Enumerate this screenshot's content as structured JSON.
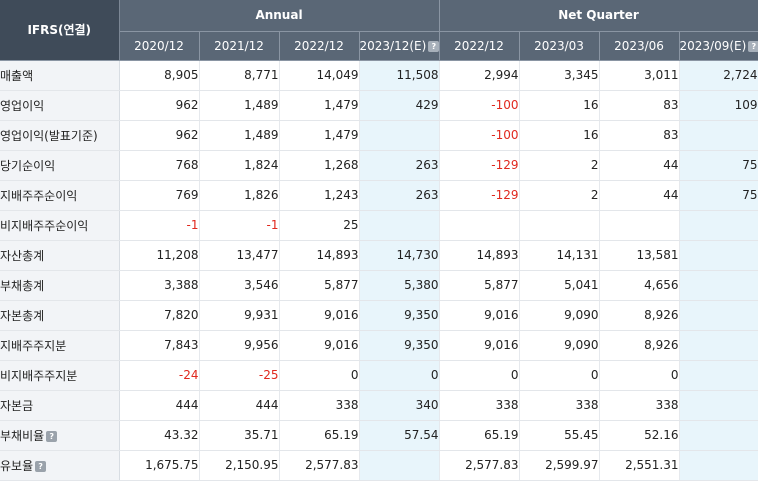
{
  "header": {
    "ifrs_label": "IFRS(연결)",
    "annual_label": "Annual",
    "quarter_label": "Net Quarter",
    "annual_periods": [
      "2020/12",
      "2021/12",
      "2022/12",
      "2023/12(E)"
    ],
    "quarter_periods": [
      "2022/12",
      "2023/03",
      "2023/06",
      "2023/09(E)"
    ],
    "help_glyph": "?"
  },
  "rows": [
    {
      "label": "매출액",
      "indent": false,
      "help": false,
      "values": [
        "8,905",
        "8,771",
        "14,049",
        "11,508",
        "2,994",
        "3,345",
        "3,011",
        "2,724"
      ]
    },
    {
      "label": "영업이익",
      "indent": false,
      "help": false,
      "values": [
        "962",
        "1,489",
        "1,479",
        "429",
        "-100",
        "16",
        "83",
        "109"
      ]
    },
    {
      "label": "영업이익(발표기준)",
      "indent": false,
      "help": false,
      "values": [
        "962",
        "1,489",
        "1,479",
        "",
        "-100",
        "16",
        "83",
        ""
      ]
    },
    {
      "label": "당기순이익",
      "indent": false,
      "help": false,
      "values": [
        "768",
        "1,824",
        "1,268",
        "263",
        "-129",
        "2",
        "44",
        "75"
      ]
    },
    {
      "label": "지배주주순이익",
      "indent": true,
      "help": false,
      "values": [
        "769",
        "1,826",
        "1,243",
        "263",
        "-129",
        "2",
        "44",
        "75"
      ]
    },
    {
      "label": "비지배주주순이익",
      "indent": true,
      "help": false,
      "values": [
        "-1",
        "-1",
        "25",
        "",
        "",
        "",
        "",
        ""
      ]
    },
    {
      "label": "자산총계",
      "indent": false,
      "help": false,
      "values": [
        "11,208",
        "13,477",
        "14,893",
        "14,730",
        "14,893",
        "14,131",
        "13,581",
        ""
      ]
    },
    {
      "label": "부채총계",
      "indent": false,
      "help": false,
      "values": [
        "3,388",
        "3,546",
        "5,877",
        "5,380",
        "5,877",
        "5,041",
        "4,656",
        ""
      ]
    },
    {
      "label": "자본총계",
      "indent": false,
      "help": false,
      "values": [
        "7,820",
        "9,931",
        "9,016",
        "9,350",
        "9,016",
        "9,090",
        "8,926",
        ""
      ]
    },
    {
      "label": "지배주주지분",
      "indent": true,
      "help": false,
      "values": [
        "7,843",
        "9,956",
        "9,016",
        "9,350",
        "9,016",
        "9,090",
        "8,926",
        ""
      ]
    },
    {
      "label": "비지배주주지분",
      "indent": true,
      "help": false,
      "values": [
        "-24",
        "-25",
        "0",
        "0",
        "0",
        "0",
        "0",
        ""
      ]
    },
    {
      "label": "자본금",
      "indent": false,
      "help": false,
      "values": [
        "444",
        "444",
        "338",
        "340",
        "338",
        "338",
        "338",
        ""
      ]
    },
    {
      "label": "부채비율",
      "indent": false,
      "help": true,
      "values": [
        "43.32",
        "35.71",
        "65.19",
        "57.54",
        "65.19",
        "55.45",
        "52.16",
        ""
      ]
    },
    {
      "label": "유보율",
      "indent": false,
      "help": true,
      "values": [
        "1,675.75",
        "2,150.95",
        "2,577.83",
        "",
        "2,577.83",
        "2,599.97",
        "2,551.31",
        ""
      ]
    }
  ],
  "colors": {
    "header_bg": "#5a6776",
    "header_dark": "#3f4b59",
    "label_bg": "#f2f4f7",
    "estimate_bg": "#e8f5fb",
    "negative": "#e0281e"
  }
}
